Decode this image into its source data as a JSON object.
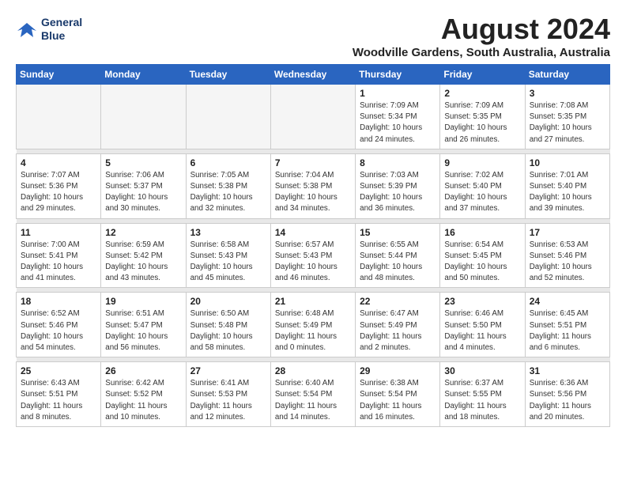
{
  "logo": {
    "line1": "General",
    "line2": "Blue"
  },
  "title": "August 2024",
  "subtitle": "Woodville Gardens, South Australia, Australia",
  "days_of_week": [
    "Sunday",
    "Monday",
    "Tuesday",
    "Wednesday",
    "Thursday",
    "Friday",
    "Saturday"
  ],
  "weeks": [
    [
      {
        "day": "",
        "info": ""
      },
      {
        "day": "",
        "info": ""
      },
      {
        "day": "",
        "info": ""
      },
      {
        "day": "",
        "info": ""
      },
      {
        "day": "1",
        "info": "Sunrise: 7:09 AM\nSunset: 5:34 PM\nDaylight: 10 hours\nand 24 minutes."
      },
      {
        "day": "2",
        "info": "Sunrise: 7:09 AM\nSunset: 5:35 PM\nDaylight: 10 hours\nand 26 minutes."
      },
      {
        "day": "3",
        "info": "Sunrise: 7:08 AM\nSunset: 5:35 PM\nDaylight: 10 hours\nand 27 minutes."
      }
    ],
    [
      {
        "day": "4",
        "info": "Sunrise: 7:07 AM\nSunset: 5:36 PM\nDaylight: 10 hours\nand 29 minutes."
      },
      {
        "day": "5",
        "info": "Sunrise: 7:06 AM\nSunset: 5:37 PM\nDaylight: 10 hours\nand 30 minutes."
      },
      {
        "day": "6",
        "info": "Sunrise: 7:05 AM\nSunset: 5:38 PM\nDaylight: 10 hours\nand 32 minutes."
      },
      {
        "day": "7",
        "info": "Sunrise: 7:04 AM\nSunset: 5:38 PM\nDaylight: 10 hours\nand 34 minutes."
      },
      {
        "day": "8",
        "info": "Sunrise: 7:03 AM\nSunset: 5:39 PM\nDaylight: 10 hours\nand 36 minutes."
      },
      {
        "day": "9",
        "info": "Sunrise: 7:02 AM\nSunset: 5:40 PM\nDaylight: 10 hours\nand 37 minutes."
      },
      {
        "day": "10",
        "info": "Sunrise: 7:01 AM\nSunset: 5:40 PM\nDaylight: 10 hours\nand 39 minutes."
      }
    ],
    [
      {
        "day": "11",
        "info": "Sunrise: 7:00 AM\nSunset: 5:41 PM\nDaylight: 10 hours\nand 41 minutes."
      },
      {
        "day": "12",
        "info": "Sunrise: 6:59 AM\nSunset: 5:42 PM\nDaylight: 10 hours\nand 43 minutes."
      },
      {
        "day": "13",
        "info": "Sunrise: 6:58 AM\nSunset: 5:43 PM\nDaylight: 10 hours\nand 45 minutes."
      },
      {
        "day": "14",
        "info": "Sunrise: 6:57 AM\nSunset: 5:43 PM\nDaylight: 10 hours\nand 46 minutes."
      },
      {
        "day": "15",
        "info": "Sunrise: 6:55 AM\nSunset: 5:44 PM\nDaylight: 10 hours\nand 48 minutes."
      },
      {
        "day": "16",
        "info": "Sunrise: 6:54 AM\nSunset: 5:45 PM\nDaylight: 10 hours\nand 50 minutes."
      },
      {
        "day": "17",
        "info": "Sunrise: 6:53 AM\nSunset: 5:46 PM\nDaylight: 10 hours\nand 52 minutes."
      }
    ],
    [
      {
        "day": "18",
        "info": "Sunrise: 6:52 AM\nSunset: 5:46 PM\nDaylight: 10 hours\nand 54 minutes."
      },
      {
        "day": "19",
        "info": "Sunrise: 6:51 AM\nSunset: 5:47 PM\nDaylight: 10 hours\nand 56 minutes."
      },
      {
        "day": "20",
        "info": "Sunrise: 6:50 AM\nSunset: 5:48 PM\nDaylight: 10 hours\nand 58 minutes."
      },
      {
        "day": "21",
        "info": "Sunrise: 6:48 AM\nSunset: 5:49 PM\nDaylight: 11 hours\nand 0 minutes."
      },
      {
        "day": "22",
        "info": "Sunrise: 6:47 AM\nSunset: 5:49 PM\nDaylight: 11 hours\nand 2 minutes."
      },
      {
        "day": "23",
        "info": "Sunrise: 6:46 AM\nSunset: 5:50 PM\nDaylight: 11 hours\nand 4 minutes."
      },
      {
        "day": "24",
        "info": "Sunrise: 6:45 AM\nSunset: 5:51 PM\nDaylight: 11 hours\nand 6 minutes."
      }
    ],
    [
      {
        "day": "25",
        "info": "Sunrise: 6:43 AM\nSunset: 5:51 PM\nDaylight: 11 hours\nand 8 minutes."
      },
      {
        "day": "26",
        "info": "Sunrise: 6:42 AM\nSunset: 5:52 PM\nDaylight: 11 hours\nand 10 minutes."
      },
      {
        "day": "27",
        "info": "Sunrise: 6:41 AM\nSunset: 5:53 PM\nDaylight: 11 hours\nand 12 minutes."
      },
      {
        "day": "28",
        "info": "Sunrise: 6:40 AM\nSunset: 5:54 PM\nDaylight: 11 hours\nand 14 minutes."
      },
      {
        "day": "29",
        "info": "Sunrise: 6:38 AM\nSunset: 5:54 PM\nDaylight: 11 hours\nand 16 minutes."
      },
      {
        "day": "30",
        "info": "Sunrise: 6:37 AM\nSunset: 5:55 PM\nDaylight: 11 hours\nand 18 minutes."
      },
      {
        "day": "31",
        "info": "Sunrise: 6:36 AM\nSunset: 5:56 PM\nDaylight: 11 hours\nand 20 minutes."
      }
    ]
  ]
}
